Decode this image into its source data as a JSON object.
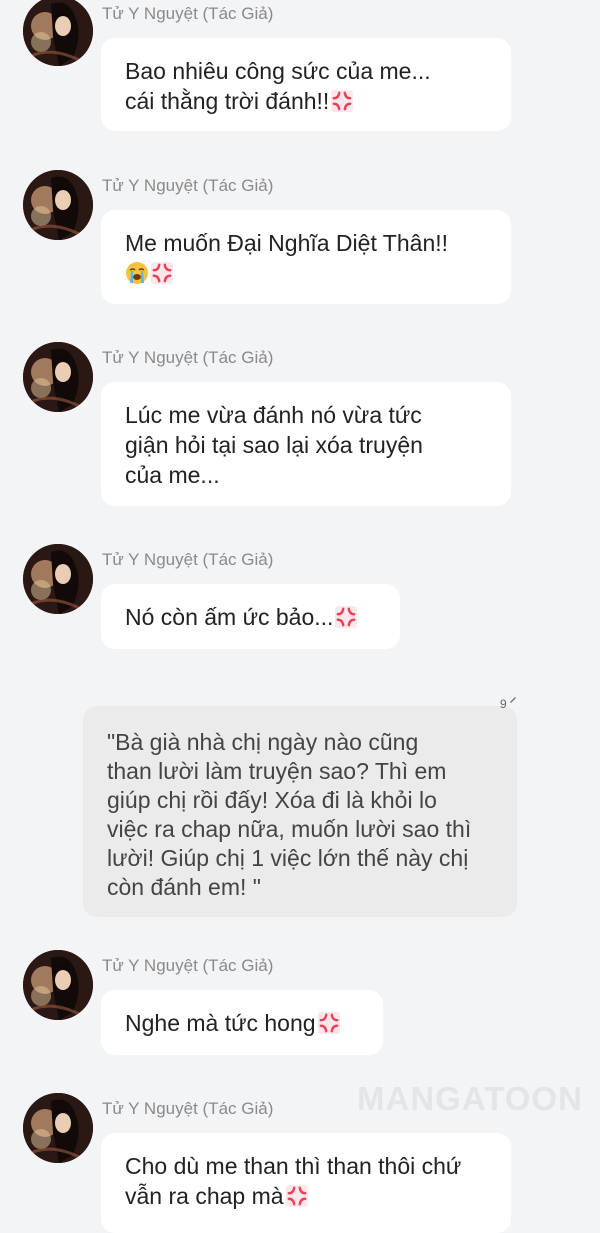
{
  "messages": [
    {
      "sender": "Tử Y Nguyệt (Tác Giả)",
      "lines": [
        "Bao nhiêu công sức của me...",
        "cái thằng trời đánh!!"
      ]
    },
    {
      "sender": "Tử Y Nguyệt (Tác Giả)",
      "lines": [
        "Me muốn Đại Nghĩa Diệt Thân!!",
        ""
      ]
    },
    {
      "sender": "Tử Y Nguyệt (Tác Giả)",
      "lines": [
        "Lúc me vừa đánh nó vừa tức",
        "giận hỏi tại sao lại xóa truyện",
        "của me..."
      ]
    },
    {
      "sender": "Tử Y Nguyệt (Tác Giả)",
      "lines": [
        "Nó còn ấm ức bảo..."
      ]
    },
    {
      "sender": "Tử Y Nguyệt (Tác Giả)",
      "lines": [
        "Nghe mà tức hong"
      ]
    },
    {
      "sender": "Tử Y Nguyệt (Tác Giả)",
      "lines": [
        "Cho dù me than thì than thôi chứ",
        "vẫn ra chap mà"
      ]
    }
  ],
  "narration": {
    "badge": "9",
    "lines": [
      "\"Bà già nhà chị ngày nào cũng",
      "than lười làm truyện sao? Thì em",
      "giúp chị rồi đấy! Xóa đi là khỏi lo",
      "việc ra chap nữa, muốn lười sao thì",
      "lười! Giúp chị 1 việc lớn thế này chị",
      "còn đánh em! \""
    ]
  },
  "watermark": "MANGATOON",
  "icons": {
    "anger": "anger-symbol-icon",
    "cry": "loudly-crying-face-icon"
  },
  "colors": {
    "background": "#f3f4f6",
    "bubble": "#ffffff",
    "narration_bubble": "#ebebeb",
    "anger": "#e8425a"
  }
}
